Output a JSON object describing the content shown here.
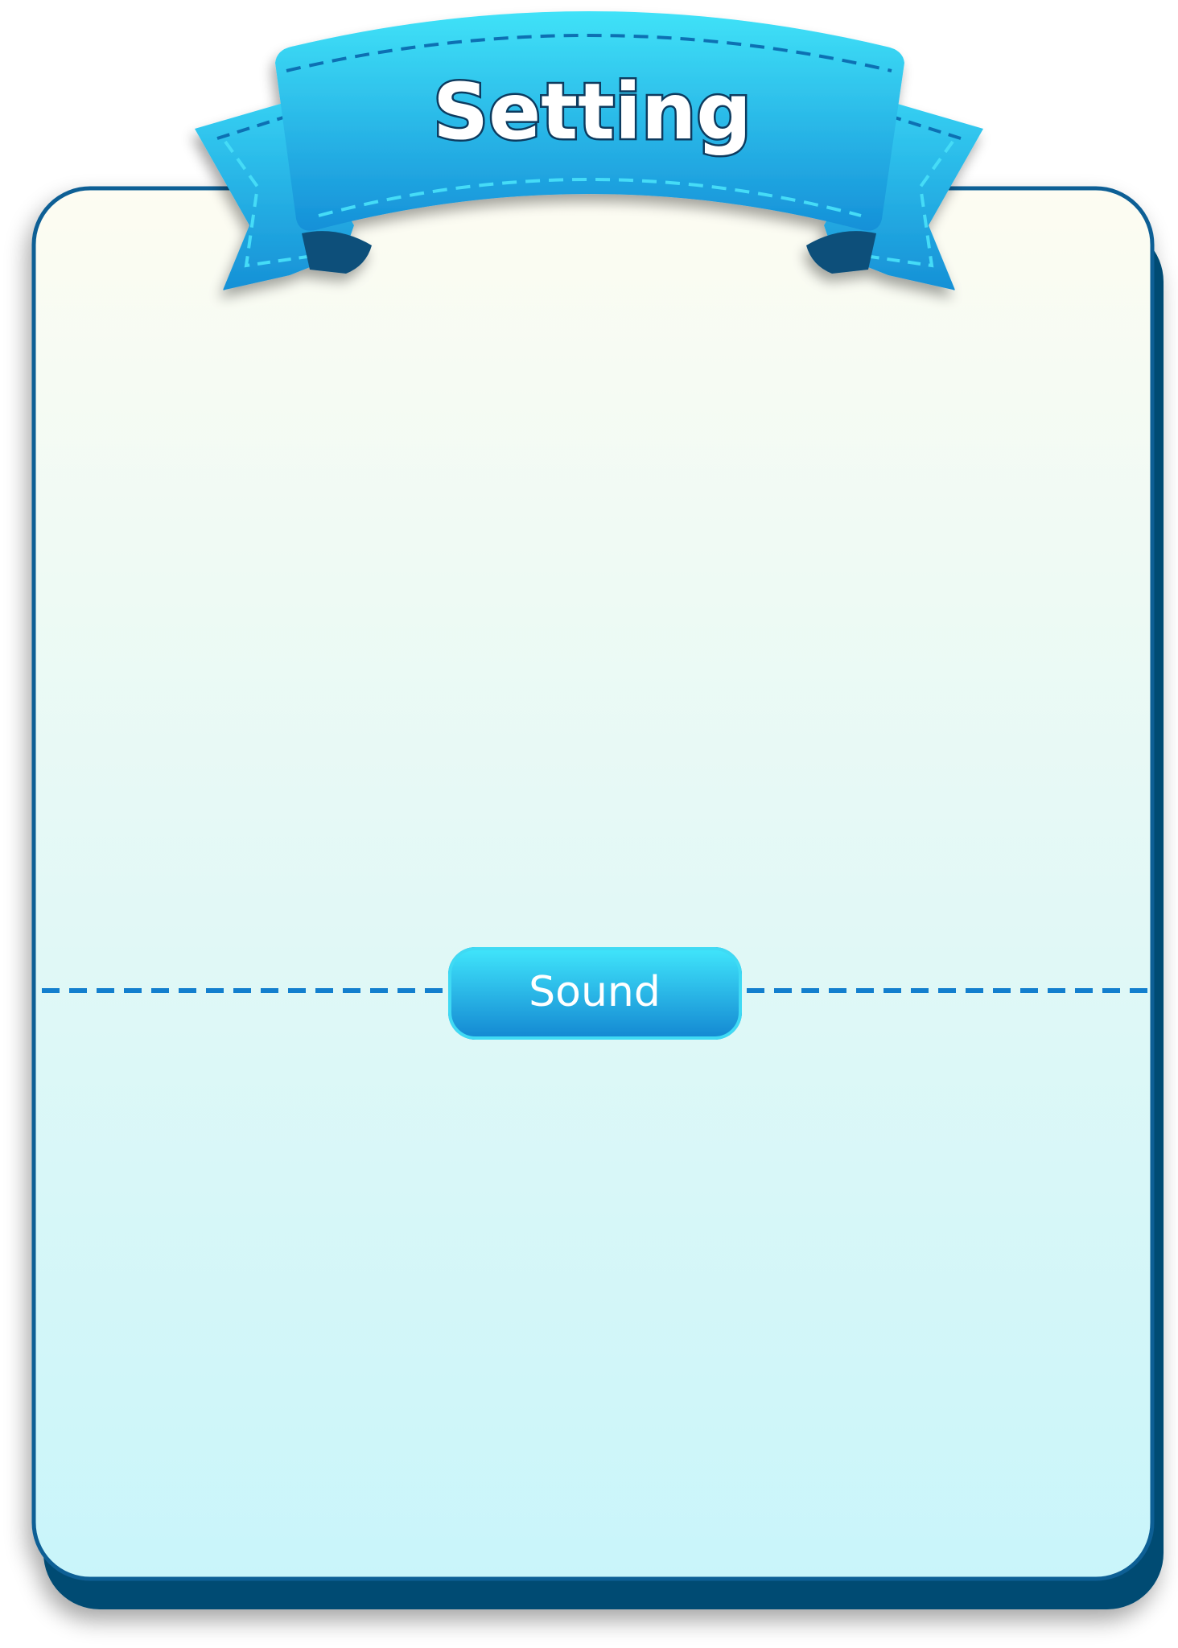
{
  "panel": {
    "title": "Setting"
  },
  "sections": [
    {
      "label": "Sound"
    }
  ],
  "colors": {
    "panel_border": "#0e5f95",
    "panel_shadow": "#064c73",
    "panel_top": "#fdfcf2",
    "panel_bottom": "#c9f5fa",
    "ribbon_light": "#40e2f8",
    "ribbon_dark": "#1590d8",
    "ribbon_edge": "#0a74b9",
    "stitch_dark": "#0f6fb3",
    "stitch_light": "#45dcf7",
    "divider": "#137fce",
    "title_fill": "#ffffff",
    "title_stroke": "#0c3a5e"
  }
}
